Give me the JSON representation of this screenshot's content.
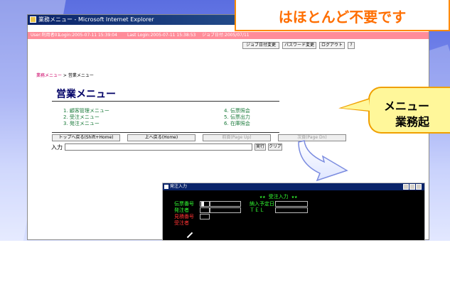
{
  "banner": {
    "text": "はほとんど不要です"
  },
  "window": {
    "title": "業務メニュー - Microsoft Internet Explorer"
  },
  "infobar": {
    "user": "User:利用者01",
    "login": "Login:2005-07-11 15:39:04",
    "last_login": "Last Login:2005-07-11 15:38:53",
    "job_date": "ジョブ日付:2005/07/11"
  },
  "toolbar": {
    "job_date_change": "ジョブ日付変更",
    "password_change": "パスワード変更",
    "logout": "ログアウト",
    "help": "?"
  },
  "breadcrumb": {
    "link": "業務メニュー",
    "separator": " > ",
    "current": "営業メニュー"
  },
  "page": {
    "title": "営業メニュー"
  },
  "menu": {
    "left": [
      "1. 顧客管理メニュー",
      "2. 受注メニュー",
      "3. 発注メニュー"
    ],
    "right": [
      "4. 伝票照会",
      "5. 伝票出力",
      "6. 在庫照会"
    ]
  },
  "nav": {
    "top": "トップへ戻る(Shift+Home)",
    "up": "上へ戻る(Home)",
    "prev": "前頁(Page Up)",
    "next": "次頁(Page Dn)"
  },
  "input": {
    "label": "入力",
    "value": "",
    "run": "実行",
    "clear": "クリア"
  },
  "bubble": {
    "line1": "メニュー",
    "line2": "業務起"
  },
  "terminal": {
    "title": "発注入力",
    "header": "★★ 受注入力 ★★",
    "fields": {
      "voucher_no": "伝票番号",
      "orderer": "発注者",
      "estimate_no": "見積番号",
      "receiver": "受注者",
      "delivery_date": "納入予定日",
      "tel": "ＴＥＬ"
    }
  },
  "colors": {
    "accent_orange": "#ff6e00",
    "infobar_pink": "#ff8c99",
    "menu_green": "#1a7a3a",
    "title_navy": "#000066",
    "terminal_green": "#33ff33",
    "terminal_red": "#ff3333"
  }
}
